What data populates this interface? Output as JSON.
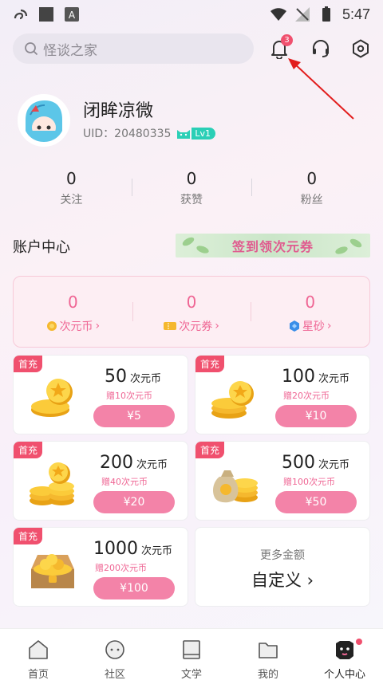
{
  "status_bar": {
    "time": "5:47"
  },
  "search": {
    "placeholder": "怪谈之家"
  },
  "notifications": {
    "count": "3"
  },
  "profile": {
    "name": "闭眸凉微",
    "uid_label": "UID：",
    "uid": "20480335",
    "level": "Lv1"
  },
  "stats": [
    {
      "value": "0",
      "label": "关注"
    },
    {
      "value": "0",
      "label": "获赞"
    },
    {
      "value": "0",
      "label": "粉丝"
    }
  ],
  "account": {
    "title": "账户中心",
    "checkin_banner": "签到领次元券"
  },
  "wallet": [
    {
      "value": "0",
      "label": "次元币"
    },
    {
      "value": "0",
      "label": "次元券"
    },
    {
      "value": "0",
      "label": "星砂"
    }
  ],
  "recharge": {
    "first_tag": "首充",
    "unit": "次元币",
    "options": [
      {
        "amount": "50",
        "bonus": "赠10次元币",
        "price": "¥5"
      },
      {
        "amount": "100",
        "bonus": "赠20次元币",
        "price": "¥10"
      },
      {
        "amount": "200",
        "bonus": "赠40次元币",
        "price": "¥20"
      },
      {
        "amount": "500",
        "bonus": "赠100次元币",
        "price": "¥50"
      },
      {
        "amount": "1000",
        "bonus": "赠200次元币",
        "price": "¥100"
      }
    ],
    "custom": {
      "more": "更多金额",
      "label": "自定义"
    }
  },
  "tabs": [
    {
      "label": "首页"
    },
    {
      "label": "社区"
    },
    {
      "label": "文学"
    },
    {
      "label": "我的"
    },
    {
      "label": "个人中心"
    }
  ],
  "colors": {
    "accent": "#f383a8",
    "badge": "#f0506e",
    "wallet_bg": "#fdeef3"
  }
}
